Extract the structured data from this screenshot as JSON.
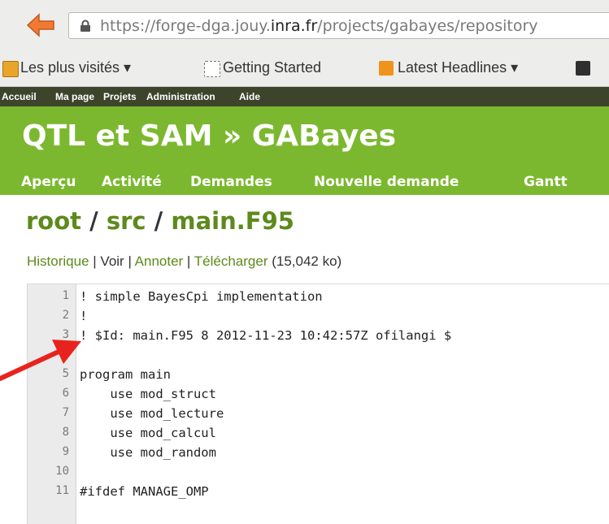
{
  "browser": {
    "url_scheme": "https://",
    "url_prefix": "forge-dga.jouy.",
    "url_domain": "inra.fr",
    "url_path": "/projects/gabayes/repository"
  },
  "bookmarks": [
    {
      "label": "Les plus visités ▾"
    },
    {
      "label": "Getting Started"
    },
    {
      "label": "Latest Headlines ▾"
    }
  ],
  "topmenu": [
    "Accueil",
    "Ma page",
    "Projets",
    "Administration",
    "Aide"
  ],
  "project": {
    "title": "QTL et SAM » GABayes"
  },
  "tabs": [
    "Aperçu",
    "Activité",
    "Demandes",
    "Nouvelle demande",
    "Gantt"
  ],
  "breadcrumb": {
    "root": "root",
    "sep1": " / ",
    "src": "src",
    "sep2": " / ",
    "file": "main.F95"
  },
  "file_actions": {
    "history": "Historique",
    "sep1": " | ",
    "view": "Voir",
    "sep2": " | ",
    "annotate": "Annoter",
    "sep3": " | ",
    "download": "Télécharger",
    "size": " (15,042 ko)"
  },
  "code_lines": [
    {
      "n": "1",
      "text": "! simple BayesCpi implementation"
    },
    {
      "n": "2",
      "text": "!"
    },
    {
      "n": "3",
      "text": "! $Id: main.F95 8 2012-11-23 10:42:57Z ofilangi $"
    },
    {
      "n": "4",
      "text": ""
    },
    {
      "n": "5",
      "text": "program main"
    },
    {
      "n": "6",
      "text": "    use mod_struct"
    },
    {
      "n": "7",
      "text": "    use mod_lecture"
    },
    {
      "n": "8",
      "text": "    use mod_calcul"
    },
    {
      "n": "9",
      "text": "    use mod_random"
    },
    {
      "n": "10",
      "text": ""
    },
    {
      "n": "11",
      "text": "#ifdef MANAGE_OMP"
    }
  ],
  "colors": {
    "header_green": "#7cb82f",
    "link_green": "#5d8a1c",
    "topmenu_bg": "#3e442c",
    "arrow_red": "#e8231e"
  }
}
